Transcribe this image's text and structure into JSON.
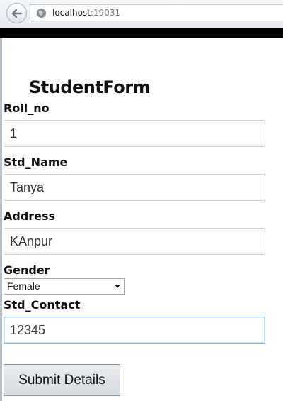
{
  "browser": {
    "url_host": "localhost",
    "url_port": ":19031"
  },
  "form": {
    "heading": "StudentForm",
    "roll_no_label": "Roll_no",
    "roll_no_value": "1",
    "name_label": "Std_Name",
    "name_value": "Tanya",
    "address_label": "Address",
    "address_value": "KAnpur",
    "gender_label": "Gender",
    "gender_selected": "Female",
    "contact_label": "Std_Contact",
    "contact_value": "12345",
    "submit_label": "Submit Details"
  },
  "colors": {
    "top_bar": "#000000",
    "focused_border": "#7fb4e0"
  },
  "icons": {
    "back": "back-arrow-icon",
    "site": "globe-icon",
    "dropdown": "chevron-down-icon"
  }
}
